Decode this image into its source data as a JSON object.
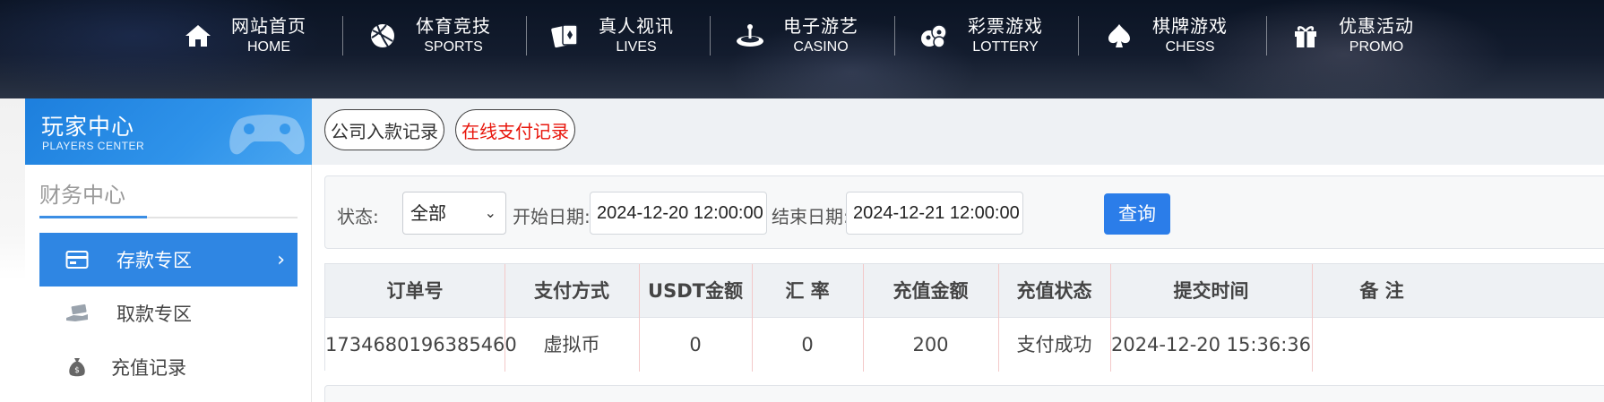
{
  "nav": {
    "items": [
      {
        "zh": "网站首页",
        "en": "HOME",
        "icon": "home-icon"
      },
      {
        "zh": "体育竞技",
        "en": "SPORTS",
        "icon": "basketball-icon"
      },
      {
        "zh": "真人视讯",
        "en": "LIVES",
        "icon": "cards-icon"
      },
      {
        "zh": "电子游艺",
        "en": "CASINO",
        "icon": "roulette-icon"
      },
      {
        "zh": "彩票游戏",
        "en": "LOTTERY",
        "icon": "lottery-balls-icon"
      },
      {
        "zh": "棋牌游戏",
        "en": "CHESS",
        "icon": "spade-icon"
      },
      {
        "zh": "优惠活动",
        "en": "PROMO",
        "icon": "gift-icon"
      }
    ]
  },
  "sidebar": {
    "header_title": "玩家中心",
    "header_sub": "PLAYERS CENTER",
    "section_title": "财务中心",
    "items": [
      {
        "label": "存款专区",
        "icon": "card-icon",
        "active": true
      },
      {
        "label": "取款专区",
        "icon": "hand-money-icon",
        "active": false
      },
      {
        "label": "充值记录",
        "icon": "money-bag-icon",
        "active": false
      }
    ]
  },
  "tabs": [
    {
      "label": "公司入款记录",
      "active": false
    },
    {
      "label": "在线支付记录",
      "active": true
    }
  ],
  "filter": {
    "status_label": "状态:",
    "status_value": "全部",
    "start_label": "开始日期:",
    "start_value": "2024-12-20 12:00:00",
    "end_label": "结束日期:",
    "end_value": "2024-12-21 12:00:00",
    "query_label": "查询"
  },
  "table": {
    "headers": [
      "订单号",
      "支付方式",
      "USDT金额",
      "汇 率",
      "充值金额",
      "充值状态",
      "提交时间",
      "备 注"
    ],
    "rows": [
      [
        "1734680196385460",
        "虚拟币",
        "0",
        "0",
        "200",
        "支付成功",
        "2024-12-20 15:36:36",
        ""
      ]
    ]
  },
  "colors": {
    "accent": "#2f86e3",
    "tab_active_text": "#e8160c",
    "query_button": "#2b7de9"
  }
}
